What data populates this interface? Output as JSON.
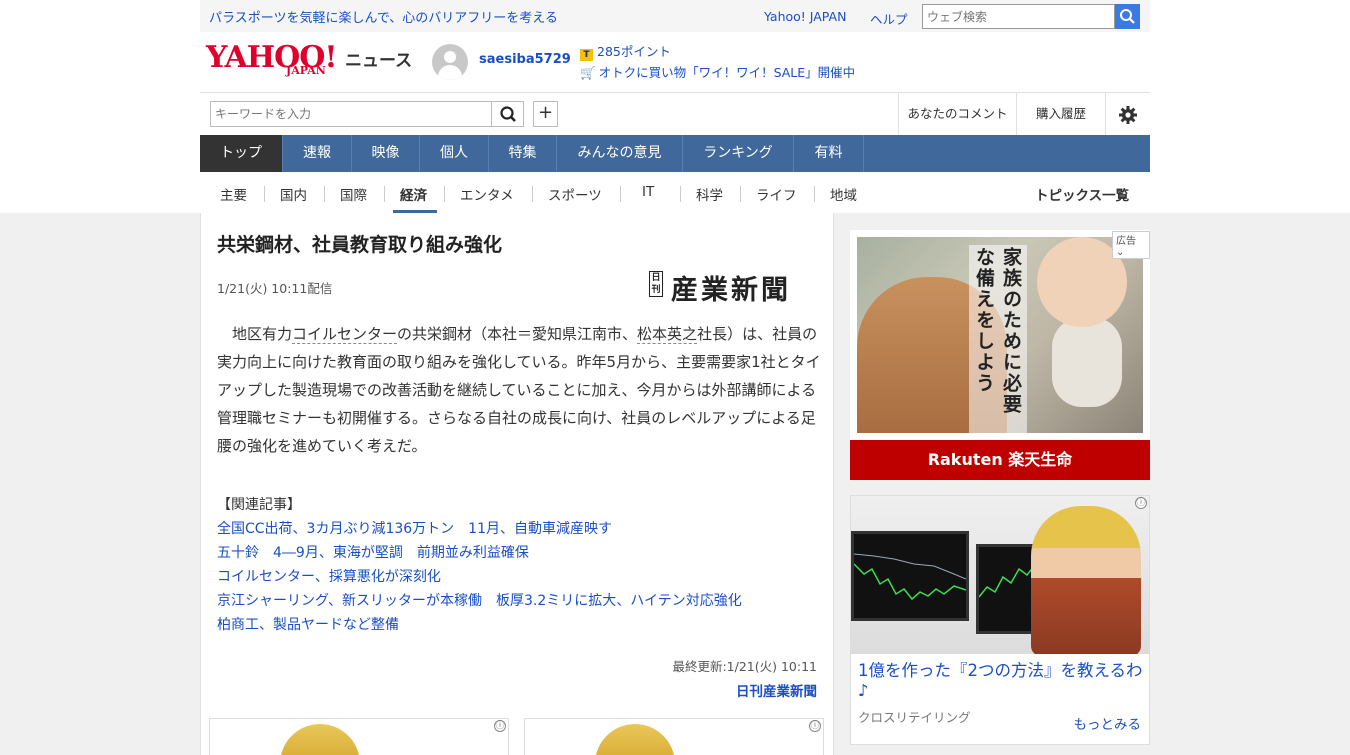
{
  "topbar": {
    "tagline": "パラスポーツを気軽に楽しんで、心のバリアフリーを考える",
    "yahoo_japan": "Yahoo! JAPAN",
    "help": "ヘルプ",
    "web_search_placeholder": "ウェブ検索"
  },
  "header": {
    "logo_yahoo": "YAHOO!",
    "logo_japan": "JAPAN",
    "logo_news": "ニュース",
    "username": "saesiba5729",
    "points": "285ポイント",
    "sale": "オトクに買い物「ワイ！ワイ！SALE」開催中"
  },
  "search_row": {
    "keyword_placeholder": "キーワードを入力",
    "plus": "+",
    "your_comments": "あなたのコメント",
    "purchase_history": "購入履歴"
  },
  "main_nav": [
    "トップ",
    "速報",
    "映像",
    "個人",
    "特集",
    "みんなの意見",
    "ランキング",
    "有料"
  ],
  "sub_nav": [
    "主要",
    "国内",
    "国際",
    "経済",
    "エンタメ",
    "スポーツ",
    "IT",
    "科学",
    "ライフ",
    "地域"
  ],
  "topics_list": "トピックス一覧",
  "article": {
    "title": "共栄鋼材、社員教育取り組み強化",
    "date": "1/21(火) 10:11配信",
    "publisher_logo_small": "日刊",
    "publisher_logo_big": "産業新聞",
    "body_before1": "　地区有力",
    "body_link1": "コイルセンター",
    "body_mid": "の共栄鋼材（本社＝愛知県江南市、",
    "body_link2": "松本英之",
    "body_after": "社長）は、社員の実力向上に向けた教育面の取り組みを強化している。昨年5月から、主要需要家1社とタイアップした製造現場での改善活動を継続していることに加え、今月からは外部講師による管理職セミナーも初開催する。さらなる自社の成長に向け、社員のレベルアップによる足腰の強化を進めていく考えだ。",
    "related_heading": "【関連記事】",
    "related": [
      "全国CC出荷、3カ月ぶり減136万トン　11月、自動車減産映す",
      "五十鈴　4―9月、東海が堅調　前期並み利益確保",
      "コイルセンター、採算悪化が深刻化",
      "京江シャーリング、新スリッターが本稼働　板厚3.2ミリに拡大、ハイテン対応強化",
      "柏商工、製品ヤードなど整備"
    ],
    "last_updated": "最終更新:1/21(火) 10:11",
    "publisher_name": "日刊産業新聞"
  },
  "ad1": {
    "label": "広告",
    "copy": "家族のために必要な備えをしよう",
    "brand": "Rakuten 楽天生命"
  },
  "ad2": {
    "headline": "1億を作った『2つの方法』を教えるわ♪",
    "source": "クロスリテイリング",
    "more": "もっとみる"
  },
  "icons": {
    "info": "ⓘ",
    "search_button_color": "#3c79e0",
    "nav_color": "#41689a",
    "rakuten_red": "#bf0000"
  }
}
